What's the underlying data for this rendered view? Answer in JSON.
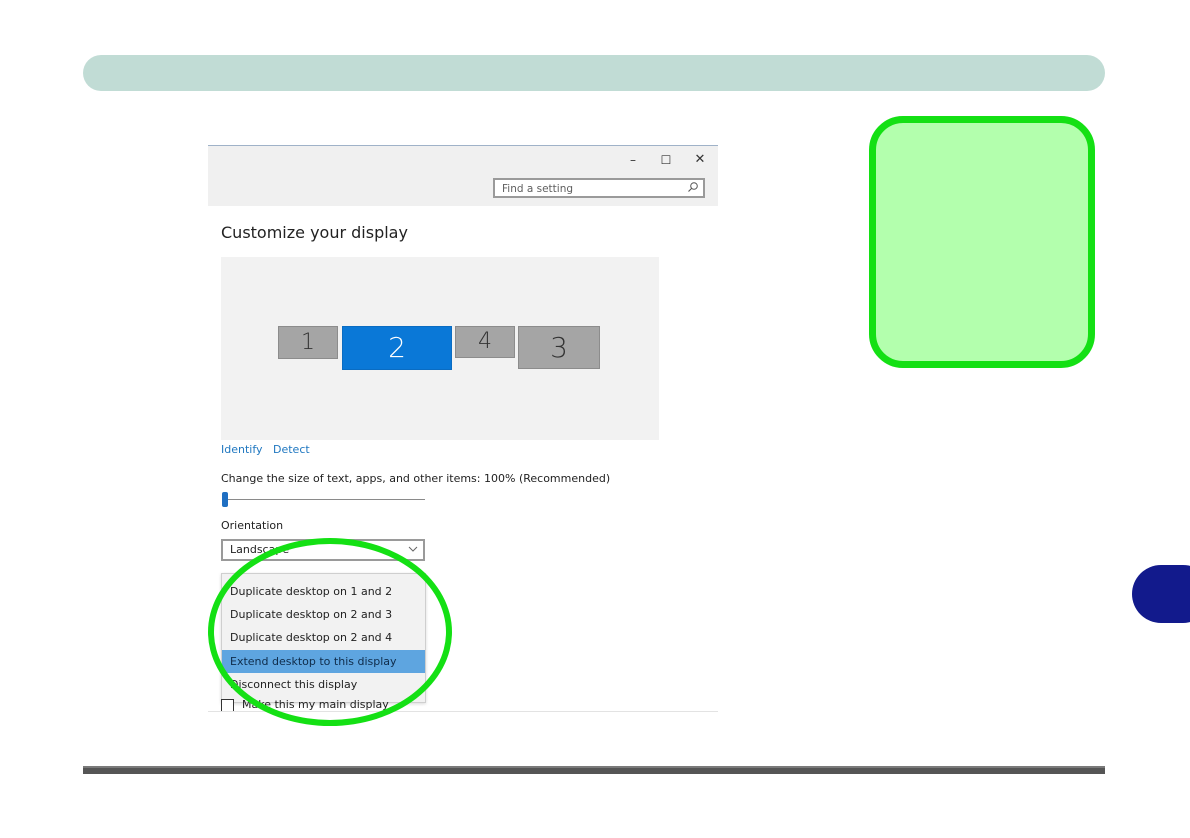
{
  "window": {
    "controls": {
      "minimize": "–",
      "maximize": "☐",
      "close": "✕"
    },
    "search_placeholder": "Find a setting"
  },
  "page_title": "Customize your display",
  "monitors": [
    "1",
    "2",
    "4",
    "3"
  ],
  "links": {
    "identify": "Identify",
    "detect": "Detect"
  },
  "scale_label": "Change the size of text, apps, and other items: 100% (Recommended)",
  "scale_level_percent": 0,
  "orientation": {
    "label": "Orientation",
    "value": "Landscape"
  },
  "multiple_displays_options": [
    "Duplicate desktop on 1 and 2",
    "Duplicate desktop on 2 and 3",
    "Duplicate desktop on 2 and 4",
    "Extend desktop to this display",
    "Disconnect this display"
  ],
  "selected_option": "Extend desktop to this display",
  "main_display_label": "Make this my main display",
  "colors": {
    "header_bar": "#c1dcd5",
    "selected_monitor": "#0a78d7",
    "selected_option": "#5ea5e0",
    "highlight_green": "#14e014",
    "callout_fill": "#b3ffad",
    "side_tab": "#121a8c",
    "link": "#1f77c0"
  }
}
